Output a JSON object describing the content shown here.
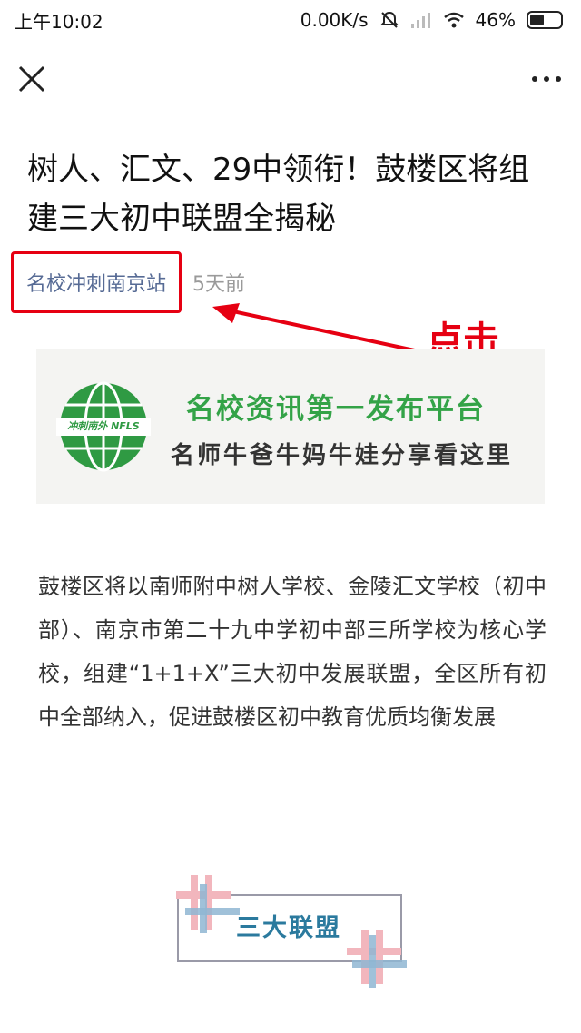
{
  "status_bar": {
    "time": "上午10:02",
    "network_speed": "0.00K/s",
    "battery": "46%",
    "battery_level": 0.46,
    "icons": [
      "mute-icon",
      "signal-icon",
      "wifi-icon",
      "battery-icon"
    ]
  },
  "nav": {
    "close_icon": "close-icon",
    "more_icon": "more-icon"
  },
  "article": {
    "title": "树人、汇文、29中领衔！鼓楼区将组建三大初中联盟全揭秘",
    "account_name": "名校冲刺南京站",
    "time_ago": "5天前"
  },
  "annotation": {
    "label": "点击",
    "color": "#e60012"
  },
  "banner": {
    "logo_text": "冲刺南外 NFLS",
    "line1": "名校资讯第一发布平台",
    "line2": "名师牛爸牛妈牛娃分享看这里",
    "accent": "#33a347"
  },
  "body": {
    "paragraph": "鼓楼区将以南师附中树人学校、金陵汇文学校（初中部）、南京市第二十九中学初中部三所学校为核心学校，组建“1+1+X”三大初中发展联盟，全区所有初中全部纳入，促进鼓楼区初中教育优质均衡发展"
  },
  "section_heading": {
    "label": "三大联盟"
  }
}
